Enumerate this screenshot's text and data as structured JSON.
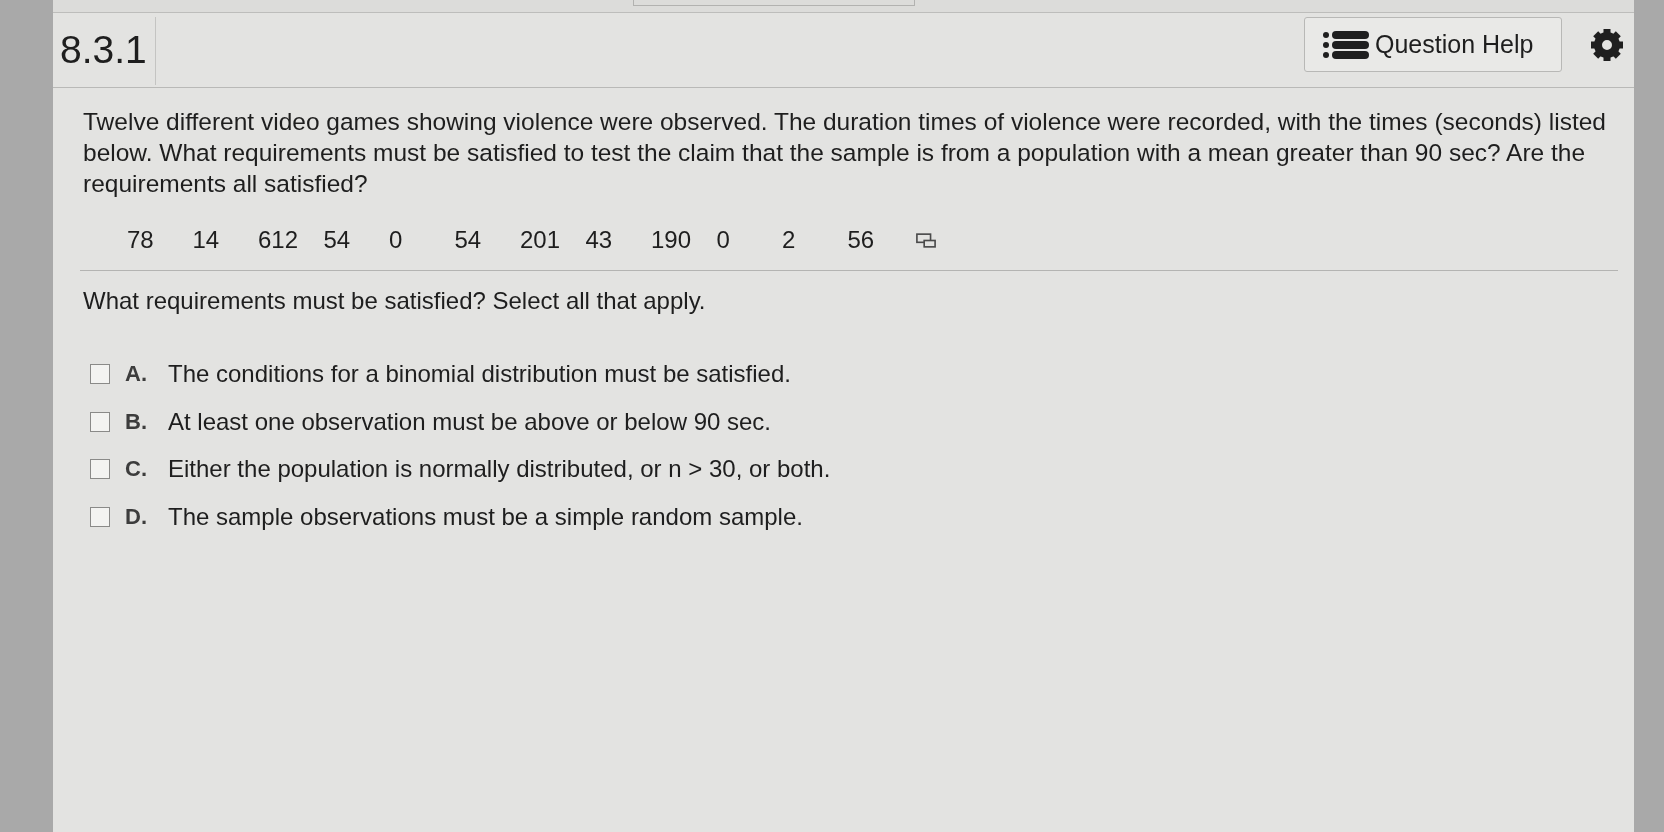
{
  "header": {
    "title": "8.3.1",
    "help_button": "Question Help"
  },
  "question": {
    "text": "Twelve different video games showing violence were observed. The duration times of violence were recorded, with the times (seconds) listed below. What requirements must be satisfied to test the claim that the sample is from a population with a mean greater than 90 sec? Are the requirements all satisfied?",
    "data_values": [
      "78",
      "14",
      "612",
      "54",
      "0",
      "54",
      "201",
      "43",
      "190",
      "0",
      "2",
      "56"
    ]
  },
  "prompt": "What requirements must be satisfied? Select all that apply.",
  "options": [
    {
      "letter": "A.",
      "text": "The conditions for a binomial distribution must be satisfied.",
      "checked": false
    },
    {
      "letter": "B.",
      "text": "At least one observation must be above or below 90 sec.",
      "checked": false
    },
    {
      "letter": "C.",
      "text": "Either the population is normally distributed, or n > 30, or both.",
      "checked": false
    },
    {
      "letter": "D.",
      "text": "The sample observations must be a simple random sample.",
      "checked": false
    }
  ]
}
